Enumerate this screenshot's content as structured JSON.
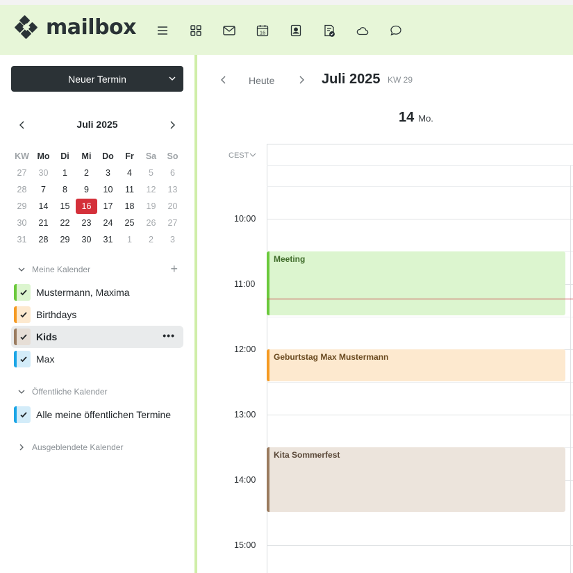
{
  "app": {
    "logo_text": "mailbox"
  },
  "nav": {
    "icons": [
      "menu-icon",
      "apps-grid-icon",
      "mail-icon",
      "calendar-icon",
      "contacts-icon",
      "tasks-icon",
      "cloud-icon",
      "chat-icon"
    ],
    "calendar_day": "16"
  },
  "sidebar": {
    "new_button_label": "Neuer Termin",
    "mini_calendar": {
      "title": "Juli 2025",
      "headers": [
        "KW",
        "Mo",
        "Di",
        "Mi",
        "Do",
        "Fr",
        "Sa",
        "So"
      ],
      "weeks": [
        [
          "27",
          "30",
          "1",
          "2",
          "3",
          "4",
          "5",
          "6"
        ],
        [
          "28",
          "7",
          "8",
          "9",
          "10",
          "11",
          "12",
          "13"
        ],
        [
          "29",
          "14",
          "15",
          "16",
          "17",
          "18",
          "19",
          "20"
        ],
        [
          "30",
          "21",
          "22",
          "23",
          "24",
          "25",
          "26",
          "27"
        ],
        [
          "31",
          "28",
          "29",
          "30",
          "31",
          "1",
          "2",
          "3"
        ]
      ],
      "today": "16"
    },
    "my_calendars_label": "Meine Kalender",
    "my_calendars": [
      {
        "label": "Mustermann, Maxima",
        "color": "#6bc93c",
        "fill": "#dcf5cf"
      },
      {
        "label": "Birthdays",
        "color": "#f59a23",
        "fill": "#fde9cf"
      },
      {
        "label": "Kids",
        "color": "#9a7b5f",
        "fill": "#e6ded6"
      },
      {
        "label": "Max",
        "color": "#1aa5e6",
        "fill": "#d3ecf9"
      }
    ],
    "public_calendars_label": "Öffentliche Kalender",
    "public_calendars": [
      {
        "label": "Alle meine öffentlichen Termine",
        "color": "#1aa5e6",
        "fill": "#d3ecf9"
      }
    ],
    "hidden_calendars_label": "Ausgeblendete Kalender"
  },
  "main": {
    "today_label": "Heute",
    "month_title": "Juli 2025",
    "week_label": "KW 29",
    "day_number": "14",
    "day_name": "Mo.",
    "timezone": "CEST",
    "time_labels": [
      "10:00",
      "11:00",
      "12:00",
      "13:00",
      "14:00",
      "15:00"
    ],
    "events": [
      {
        "title": "Meeting",
        "color": "#6bc93c",
        "fill": "#dcf5cf",
        "text_color": "#3f6b2a"
      },
      {
        "title": "Geburtstag Max Mustermann",
        "color": "#f59a23",
        "fill": "#fde9cf",
        "text_color": "#6a4a20"
      },
      {
        "title": "Kita Sommerfest",
        "color": "#9a7b5f",
        "fill": "#ece4dc",
        "text_color": "#5a4838"
      }
    ]
  }
}
